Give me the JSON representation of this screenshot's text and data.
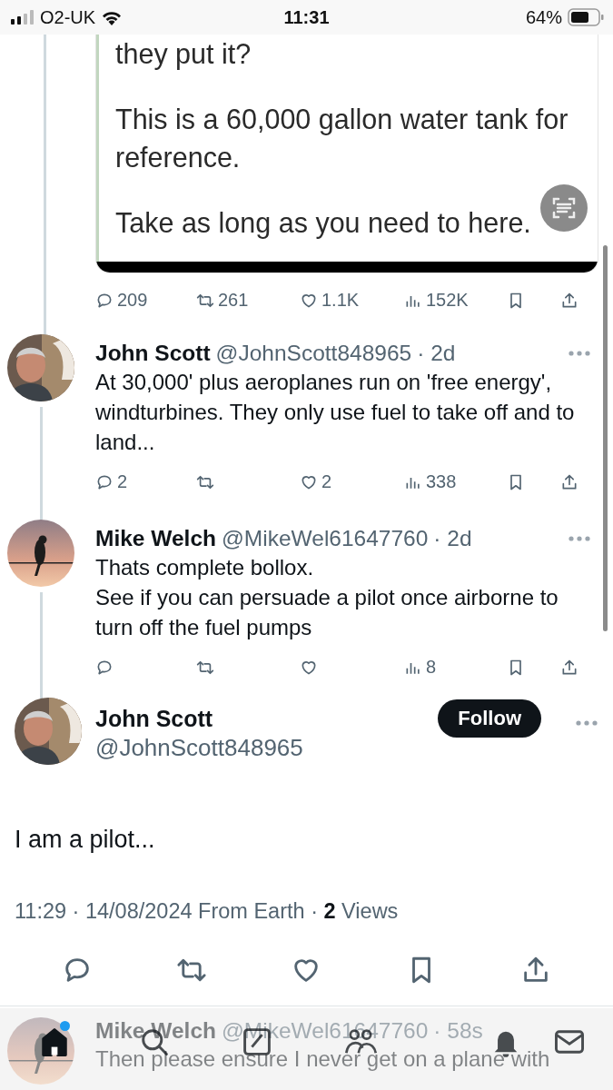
{
  "status_bar": {
    "carrier": "O2-UK",
    "time": "11:31",
    "battery": "64%"
  },
  "quoted_media": {
    "paragraphs": [
      "they put it?",
      "This is a 60,000 gallon water tank for reference.",
      "Take as long as you need to here."
    ]
  },
  "parent_actions": {
    "replies": "209",
    "reposts": "261",
    "likes": "1.1K",
    "views": "152K"
  },
  "replies": [
    {
      "name": "John Scott",
      "handle": "@JohnScott848965",
      "time": "· 2d",
      "text": "At 30,000' plus aeroplanes run on 'free energy', windturbines.  They only use fuel to take off and to land...",
      "actions": {
        "replies": "2",
        "likes": "2",
        "views": "338"
      }
    },
    {
      "name": "Mike Welch",
      "handle": "@MikeWel61647760",
      "time": "· 2d",
      "text": "Thats complete bollox.\nSee if you can persuade a pilot once airborne to turn off the fuel pumps",
      "actions": {
        "views": "8"
      }
    }
  ],
  "main_tweet": {
    "name": "John Scott",
    "handle": "@JohnScott848965",
    "follow_label": "Follow",
    "text": "I am a pilot...",
    "meta": "11:29 · 14/08/2024 From Earth · **2** Views"
  },
  "next_reply": {
    "name": "Mike Welch",
    "handle": "@MikeWel61647760",
    "time": "· 58s",
    "text": "Then please ensure I never get on a plane with"
  },
  "tab_bar": {
    "items": [
      {
        "kind": "home",
        "selected": true,
        "unread": true
      },
      {
        "kind": "search",
        "selected": false,
        "unread": false
      },
      {
        "kind": "compose",
        "selected": false,
        "unread": false
      },
      {
        "kind": "communities",
        "selected": false,
        "unread": false
      },
      {
        "kind": "notifications",
        "selected": false,
        "unread": false
      },
      {
        "kind": "messages",
        "selected": false,
        "unread": false
      }
    ]
  }
}
